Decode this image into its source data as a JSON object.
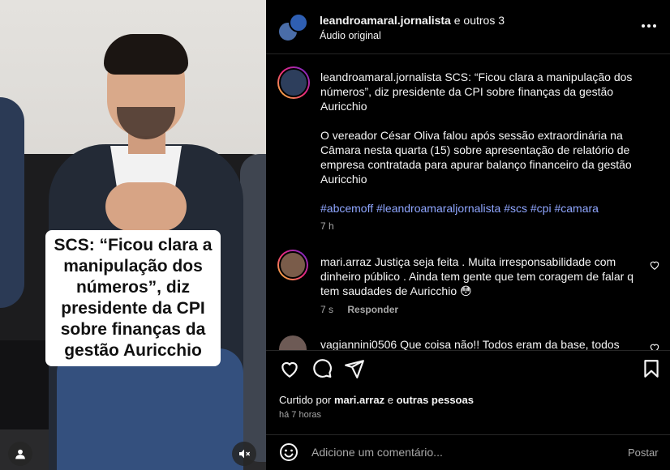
{
  "media": {
    "caption_line1": "SCS: “Ficou clara a",
    "caption_line2": "manipulação dos",
    "caption_line3": "números”, diz",
    "caption_line4": "presidente da CPI",
    "caption_line5": "sobre finanças da",
    "caption_line6": "gestão Auricchio",
    "user_icon": "person-icon",
    "mute_icon": "muted-speaker-icon"
  },
  "header": {
    "username": "leandroamaral.jornalista",
    "and_others": "e outros 3",
    "audio": "Áudio original",
    "more_icon": "more-horizontal-icon"
  },
  "post": {
    "username": "leandroamaral.jornalista",
    "title": "SCS: “Ficou clara a manipulação dos números”, diz presidente da CPI sobre finanças da gestão Auricchio",
    "body": "O vereador César Oliva falou após sessão extraordinária na Câmara nesta quarta (15) sobre apresentação de relatório de empresa contratada para apurar balanço financeiro da gestão Auricchio",
    "hashtags": "#abcemoff #leandroamaraljornalista #scs #cpi #camara",
    "time": "7 h"
  },
  "comments": [
    {
      "username": "mari.arraz",
      "text": "Justiça seja feita . Muita irresponsabilidade com dinheiro público . Ainda tem gente que tem coragem de falar q tem saudades de Auricchio 😳",
      "time": "7 s",
      "reply": "Responder"
    },
    {
      "username": "vagiannini0506",
      "text": "Que coisa não!! Todos eram da base, todos"
    }
  ],
  "actions": {
    "like_icon": "heart-icon",
    "comment_icon": "comment-icon",
    "share_icon": "share-icon",
    "save_icon": "bookmark-icon"
  },
  "likes": {
    "prefix": "Curtido por",
    "user": "mari.arraz",
    "and": "e",
    "others": "outras pessoas",
    "ago": "há 7 horas"
  },
  "comment_bar": {
    "placeholder": "Adicione um comentário...",
    "post_label": "Postar",
    "emoji_icon": "emoji-icon"
  }
}
